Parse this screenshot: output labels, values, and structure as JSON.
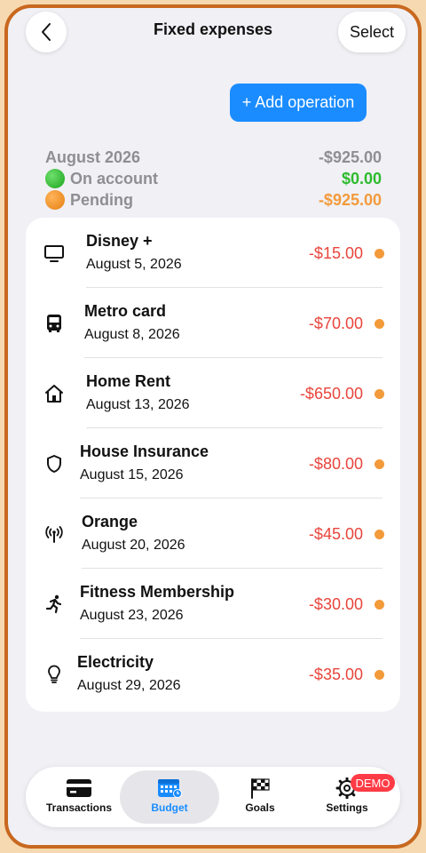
{
  "header": {
    "title": "Fixed expenses",
    "select_label": "Select"
  },
  "add_button_label": "+ Add operation",
  "summary": {
    "period": "August 2026",
    "period_total": "-$925.00",
    "on_account_label": "On account",
    "on_account_value": "$0.00",
    "pending_label": "Pending",
    "pending_value": "-$925.00"
  },
  "expenses": [
    {
      "icon": "tv-icon",
      "name": "Disney +",
      "date": "August 5, 2026",
      "amount": "-$15.00"
    },
    {
      "icon": "bus-icon",
      "name": "Metro card",
      "date": "August 8, 2026",
      "amount": "-$70.00"
    },
    {
      "icon": "house-icon",
      "name": "Home Rent",
      "date": "August 13, 2026",
      "amount": "-$650.00"
    },
    {
      "icon": "shield-icon",
      "name": "House Insurance",
      "date": "August 15, 2026",
      "amount": "-$80.00"
    },
    {
      "icon": "antenna-icon",
      "name": "Orange",
      "date": "August 20, 2026",
      "amount": "-$45.00"
    },
    {
      "icon": "runner-icon",
      "name": "Fitness Membership",
      "date": "August 23, 2026",
      "amount": "-$30.00"
    },
    {
      "icon": "lightbulb-icon",
      "name": "Electricity",
      "date": "August 29, 2026",
      "amount": "-$35.00"
    }
  ],
  "tabs": [
    {
      "icon": "credit-card-icon",
      "label": "Transactions"
    },
    {
      "icon": "calendar-icon",
      "label": "Budget"
    },
    {
      "icon": "checkered-flag-icon",
      "label": "Goals"
    },
    {
      "icon": "gear-icon",
      "label": "Settings"
    }
  ],
  "demo_badge": "DEMO",
  "colors": {
    "accent": "#1a8cff",
    "negative": "#e8453c",
    "pending": "#f39a3a",
    "positive": "#2dbb2d",
    "frame": "#c8681f"
  }
}
